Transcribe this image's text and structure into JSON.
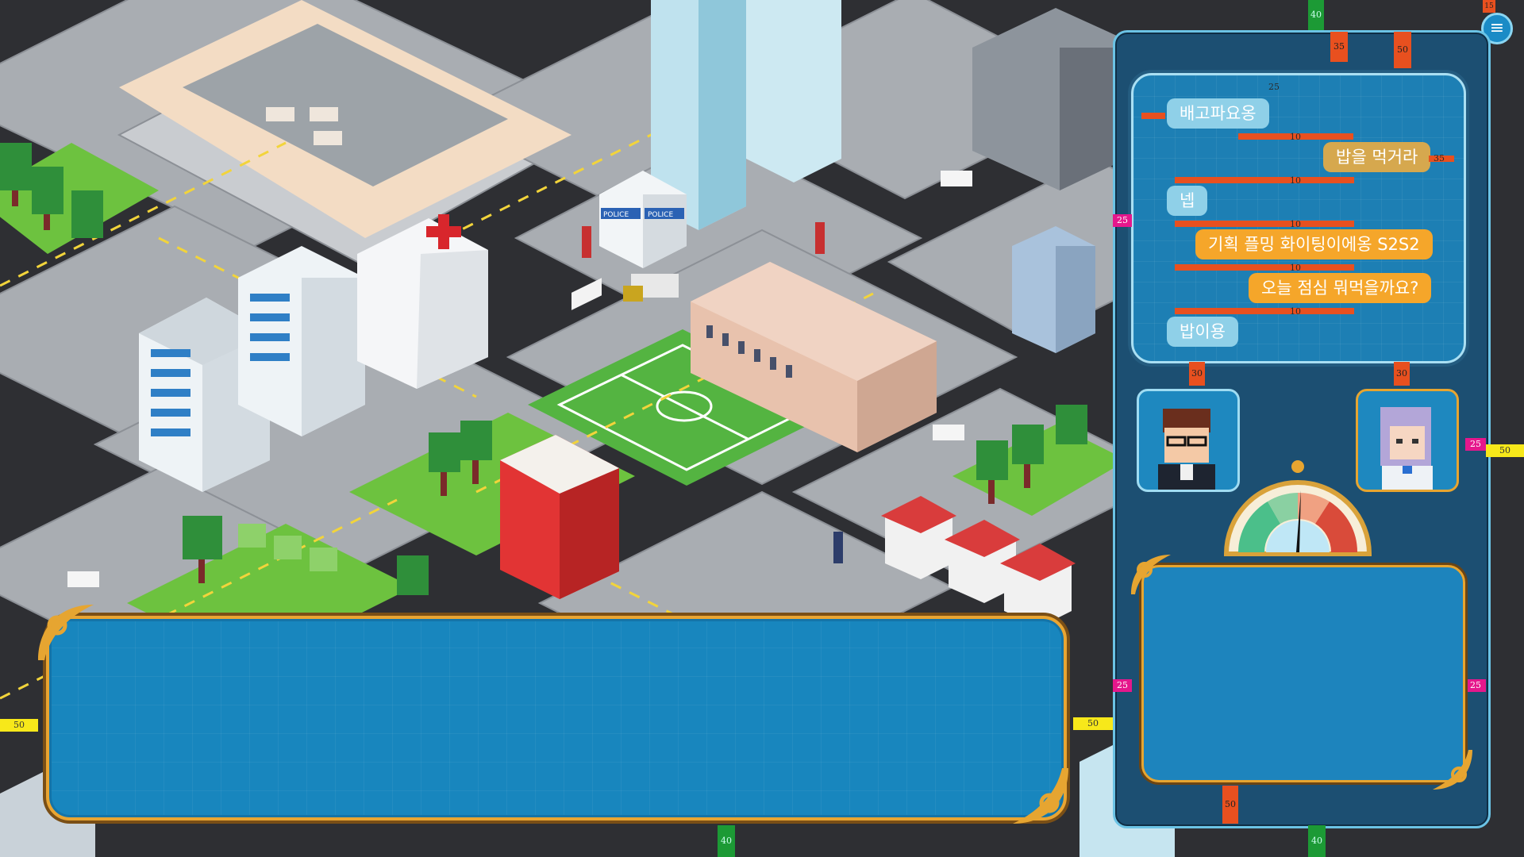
{
  "chat": {
    "messages": [
      {
        "side": "left",
        "text": "배고파요옹"
      },
      {
        "side": "right",
        "text": "밥을 먹거라"
      },
      {
        "side": "left",
        "text": "넵"
      },
      {
        "side": "right",
        "text": "기획 플밍 화이팅이에옹 S2S2"
      },
      {
        "side": "right",
        "text": "오늘 점심 뭐먹을까요?"
      },
      {
        "side": "left",
        "text": "밥이용"
      }
    ]
  },
  "map": {
    "police_sign": "POLICE",
    "police_sign_2": "POLICE"
  },
  "guides": {
    "v10": "10",
    "v15": "15",
    "v25": "25",
    "v30": "30",
    "v35": "35",
    "v40": "40",
    "v50": "50"
  },
  "menu": {
    "icon": "≡"
  },
  "colors": {
    "panel": "#1c4f72",
    "chat_bg": "#1d7fb4",
    "bubble_left": "#8fd0e8",
    "bubble_right": "#f5a62a",
    "frame_gold": "#e9a532"
  },
  "icons": [
    "menu-icon",
    "hospital-cross-icon",
    "gauge-needle-icon"
  ]
}
